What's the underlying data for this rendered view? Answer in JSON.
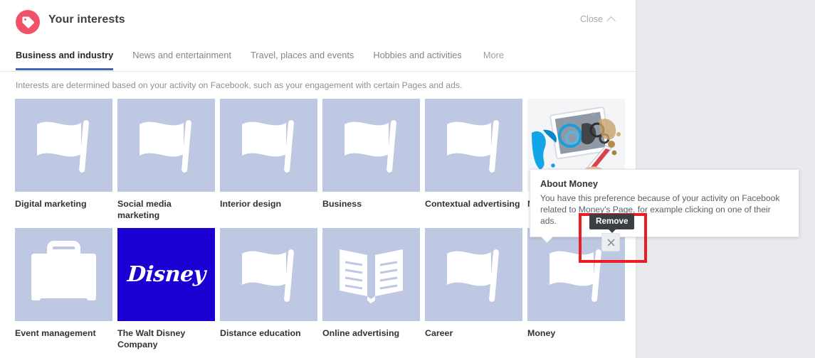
{
  "header": {
    "title": "Your interests",
    "icon": "tag-icon",
    "close_label": "Close",
    "close_chevron": "chevron-up-icon"
  },
  "tabs": [
    {
      "label": "Business and industry",
      "active": true
    },
    {
      "label": "News and entertainment",
      "active": false
    },
    {
      "label": "Travel, places and events",
      "active": false
    },
    {
      "label": "Hobbies and activities",
      "active": false
    },
    {
      "label": "More",
      "active": false
    }
  ],
  "subtitle": "Interests are determined based on your activity on Facebook, such as your engagement with certain Pages and ads.",
  "interests": [
    {
      "label": "Digital marketing",
      "thumb": "flag-icon"
    },
    {
      "label": "Social media marketing",
      "thumb": "flag-icon"
    },
    {
      "label": "Interior design",
      "thumb": "flag-icon"
    },
    {
      "label": "Business",
      "thumb": "flag-icon"
    },
    {
      "label": "Contextual advertising",
      "thumb": "flag-icon"
    },
    {
      "label": "Money",
      "thumb": "photo-tablet-drawing"
    },
    {
      "label": "Event management",
      "thumb": "briefcase-icon"
    },
    {
      "label": "The Walt Disney Company",
      "thumb": "disney-logo",
      "logo_text": "Disney"
    },
    {
      "label": "Distance education",
      "thumb": "flag-icon"
    },
    {
      "label": "Online advertising",
      "thumb": "open-book-icon"
    },
    {
      "label": "Career",
      "thumb": "flag-icon"
    },
    {
      "label": "Money",
      "thumb": "flag-icon"
    }
  ],
  "about_tooltip": {
    "title": "About Money",
    "body": "You have this preference because of your activity on Facebook related to Money's Page, for example clicking on one of their ads."
  },
  "remove_tooltip": {
    "label": "Remove"
  },
  "remove_button": {
    "icon": "close-x-icon"
  },
  "colors": {
    "page_background": "#e9eaed",
    "card_background": "#ffffff",
    "tab_accent": "#4267b2",
    "tile_placeholder": "#bfc8e2",
    "tag_icon": "#f25268",
    "disney_blue": "#1a00d2",
    "highlight_red": "#ec1c24",
    "tooltip_dark": "#3b3e42"
  }
}
